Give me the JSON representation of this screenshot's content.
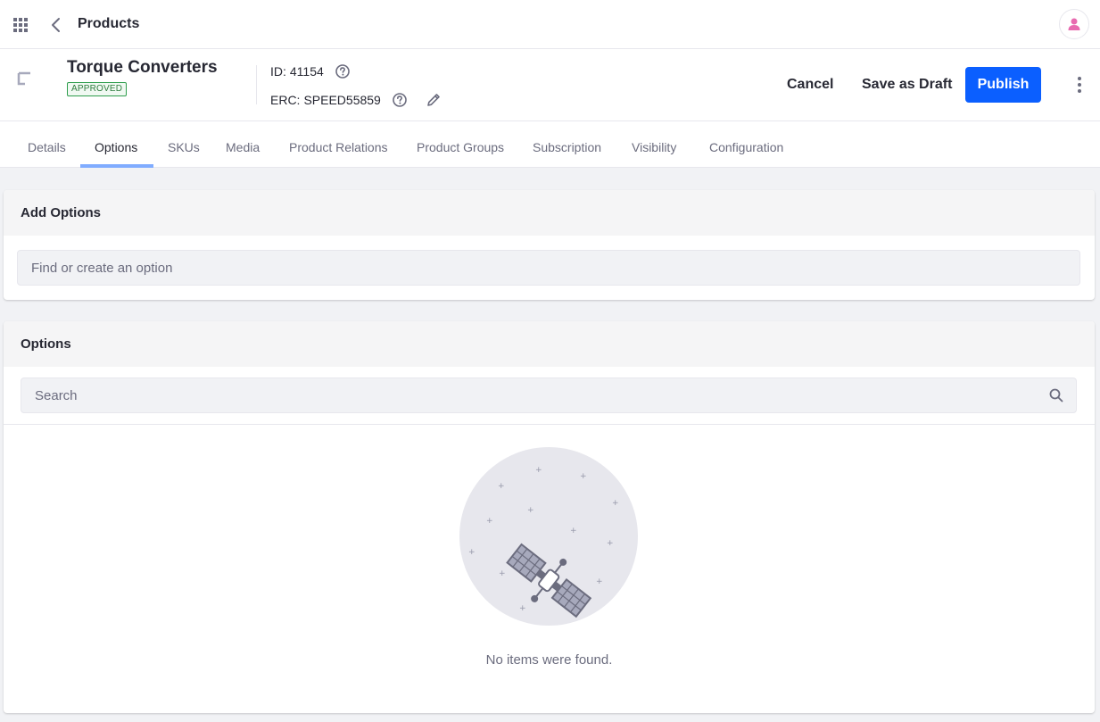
{
  "topbar": {
    "title": "Products"
  },
  "product": {
    "name": "Torque Converters",
    "status": "APPROVED",
    "id_label": "ID:",
    "id_value": "41154",
    "erc_label": "ERC:",
    "erc_value": "SPEED55859"
  },
  "actions": {
    "cancel": "Cancel",
    "save_draft": "Save as Draft",
    "publish": "Publish"
  },
  "tabs": [
    {
      "label": "Details"
    },
    {
      "label": "Options"
    },
    {
      "label": "SKUs"
    },
    {
      "label": "Media"
    },
    {
      "label": "Product Relations"
    },
    {
      "label": "Product Groups"
    },
    {
      "label": "Subscription"
    },
    {
      "label": "Visibility"
    },
    {
      "label": "Configuration"
    }
  ],
  "active_tab": "Options",
  "add_options": {
    "title": "Add Options",
    "placeholder": "Find or create an option"
  },
  "options": {
    "title": "Options",
    "search_placeholder": "Search",
    "empty_message": "No items were found."
  },
  "icons": {
    "apps": "apps-grid-icon",
    "back": "chevron-left-icon",
    "user": "user-icon",
    "product": "product-icon",
    "help": "question-circle-icon",
    "edit": "pencil-icon",
    "more": "ellipsis-vertical-icon",
    "search": "search-icon",
    "empty": "satellite-illustration"
  },
  "colors": {
    "primary": "#0b5fff",
    "approved": "#2e9d4c",
    "tab_indicator": "#80acff",
    "avatar_accent": "#e86ab0"
  }
}
